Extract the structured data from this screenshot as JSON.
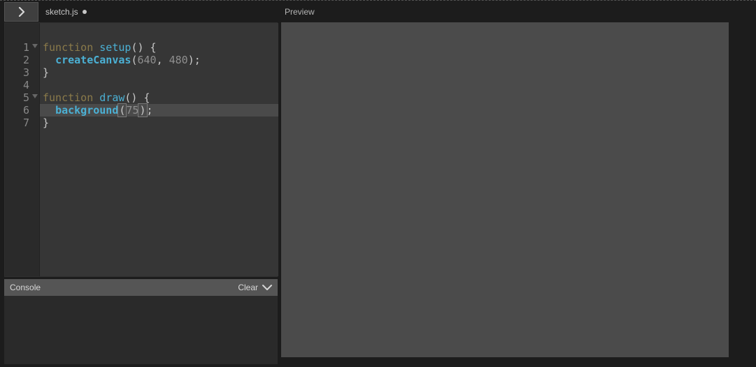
{
  "tab": {
    "filename": "sketch.js",
    "dirty": true
  },
  "preview": {
    "label": "Preview"
  },
  "console": {
    "label": "Console",
    "clear_label": "Clear"
  },
  "code": {
    "lines": [
      {
        "n": "1",
        "foldable": true,
        "tokens": [
          [
            "kw",
            "function"
          ],
          [
            "sp",
            " "
          ],
          [
            "fn",
            "setup"
          ],
          [
            "pn",
            "()"
          ],
          [
            "sp",
            " "
          ],
          [
            "pn",
            "{"
          ]
        ]
      },
      {
        "n": "2",
        "foldable": false,
        "tokens": [
          [
            "sp",
            "  "
          ],
          [
            "fnb",
            "createCanvas"
          ],
          [
            "pn",
            "("
          ],
          [
            "num",
            "640"
          ],
          [
            "pn",
            ","
          ],
          [
            "sp",
            " "
          ],
          [
            "num",
            "480"
          ],
          [
            "pn",
            ");"
          ]
        ]
      },
      {
        "n": "3",
        "foldable": false,
        "tokens": [
          [
            "pn",
            "}"
          ]
        ]
      },
      {
        "n": "4",
        "foldable": false,
        "tokens": []
      },
      {
        "n": "5",
        "foldable": true,
        "tokens": [
          [
            "kw",
            "function"
          ],
          [
            "sp",
            " "
          ],
          [
            "fn",
            "draw"
          ],
          [
            "pn",
            "()"
          ],
          [
            "sp",
            " "
          ],
          [
            "pn",
            "{"
          ]
        ]
      },
      {
        "n": "6",
        "foldable": false,
        "active": true,
        "cursor_after_num": true,
        "tokens": [
          [
            "sp",
            "  "
          ],
          [
            "fnb",
            "background"
          ],
          [
            "brpn",
            "("
          ],
          [
            "num",
            "75"
          ],
          [
            "brpn",
            ")"
          ],
          [
            "pn",
            ";"
          ]
        ]
      },
      {
        "n": "7",
        "foldable": false,
        "tokens": [
          [
            "pn",
            "}"
          ]
        ]
      }
    ]
  },
  "colors": {
    "preview_bg": "#4b4b4b",
    "editor_bg": "#363636",
    "gutter_bg": "#2a2a2a"
  }
}
